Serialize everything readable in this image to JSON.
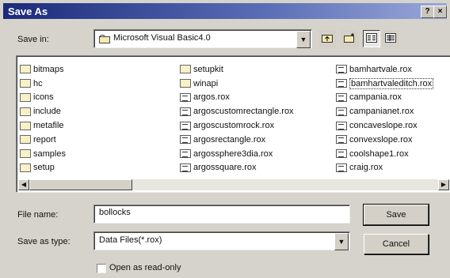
{
  "dialog": {
    "title": "Save As",
    "help_label": "?",
    "close_label": "×"
  },
  "save_in": {
    "label": "Save in:",
    "value": "Microsoft Visual Basic4.0"
  },
  "toolbar": {
    "up_icon": "up-folder-icon",
    "new_folder_icon": "new-folder-icon",
    "list_icon": "list-view-icon",
    "details_icon": "details-view-icon"
  },
  "files": {
    "column1": [
      {
        "name": "bitmaps",
        "type": "folder"
      },
      {
        "name": "hc",
        "type": "folder"
      },
      {
        "name": "icons",
        "type": "folder"
      },
      {
        "name": "include",
        "type": "folder"
      },
      {
        "name": "metafile",
        "type": "folder"
      },
      {
        "name": "report",
        "type": "folder"
      },
      {
        "name": "samples",
        "type": "folder"
      },
      {
        "name": "setup",
        "type": "folder"
      }
    ],
    "column2": [
      {
        "name": "setupkit",
        "type": "folder"
      },
      {
        "name": "winapi",
        "type": "folder"
      },
      {
        "name": "argos.rox",
        "type": "file"
      },
      {
        "name": "argoscustomrectangle.rox",
        "type": "file"
      },
      {
        "name": "argoscustomrock.rox",
        "type": "file"
      },
      {
        "name": "argosrectangle.rox",
        "type": "file"
      },
      {
        "name": "argossphere3dia.rox",
        "type": "file"
      },
      {
        "name": "argossquare.rox",
        "type": "file"
      }
    ],
    "column3": [
      {
        "name": "bamhartvale.rox",
        "type": "file"
      },
      {
        "name": "bamhartvaleditch.rox",
        "type": "file"
      },
      {
        "name": "campania.rox",
        "type": "file"
      },
      {
        "name": "campanianet.rox",
        "type": "file"
      },
      {
        "name": "concaveslope.rox",
        "type": "file"
      },
      {
        "name": "convexslope.rox",
        "type": "file"
      },
      {
        "name": "coolshape1.rox",
        "type": "file"
      },
      {
        "name": "craig.rox",
        "type": "file"
      }
    ]
  },
  "file_name": {
    "label": "File name:",
    "value": "bollocks"
  },
  "save_as_type": {
    "label": "Save as type:",
    "value": "Data Files(*.rox)"
  },
  "buttons": {
    "save": "Save",
    "cancel": "Cancel"
  },
  "read_only": {
    "label": "Open as read-only",
    "checked": false
  }
}
